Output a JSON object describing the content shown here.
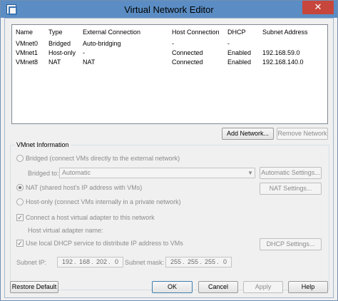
{
  "window": {
    "title": "Virtual Network Editor",
    "close_glyph": "✕"
  },
  "list": {
    "columns": [
      "Name",
      "Type",
      "External Connection",
      "Host Connection",
      "DHCP",
      "Subnet Address"
    ],
    "rows": [
      [
        "VMnet0",
        "Bridged",
        "Auto-bridging",
        "-",
        "-",
        ""
      ],
      [
        "VMnet1",
        "Host-only",
        "-",
        "Connected",
        "Enabled",
        "192.168.59.0"
      ],
      [
        "VMnet8",
        "NAT",
        "NAT",
        "Connected",
        "Enabled",
        "192.168.140.0"
      ]
    ]
  },
  "network_buttons": {
    "add": "Add Network...",
    "remove": "Remove Network"
  },
  "vmnet_info": {
    "title": "VMnet Information",
    "bridged_label": "Bridged (connect VMs directly to the external network)",
    "bridged_to_label": "Bridged to:",
    "bridged_to_value": "Automatic",
    "auto_settings": "Automatic Settings...",
    "nat_label": "NAT (shared host's IP address with VMs)",
    "nat_settings": "NAT Settings...",
    "hostonly_label": "Host-only (connect VMs internally in a private network)",
    "connect_adapter_label": "Connect a host virtual adapter to this network",
    "adapter_name_label": "Host virtual adapter name:",
    "dhcp_label": "Use local DHCP service to distribute IP address to VMs",
    "dhcp_settings": "DHCP Settings...",
    "subnet_ip_label": "Subnet IP:",
    "subnet_ip": [
      "192",
      "168",
      "202",
      "0"
    ],
    "subnet_mask_label": "Subnet mask:",
    "subnet_mask": [
      "255",
      "255",
      "255",
      "0"
    ],
    "dot": "."
  },
  "footer": {
    "restore": "Restore Default",
    "ok": "OK",
    "cancel": "Cancel",
    "apply": "Apply",
    "help": "Help"
  },
  "colors": {
    "titlebar": "#5b8dc4",
    "close": "#c7463c",
    "disabled_text": "#8b8b8b"
  }
}
